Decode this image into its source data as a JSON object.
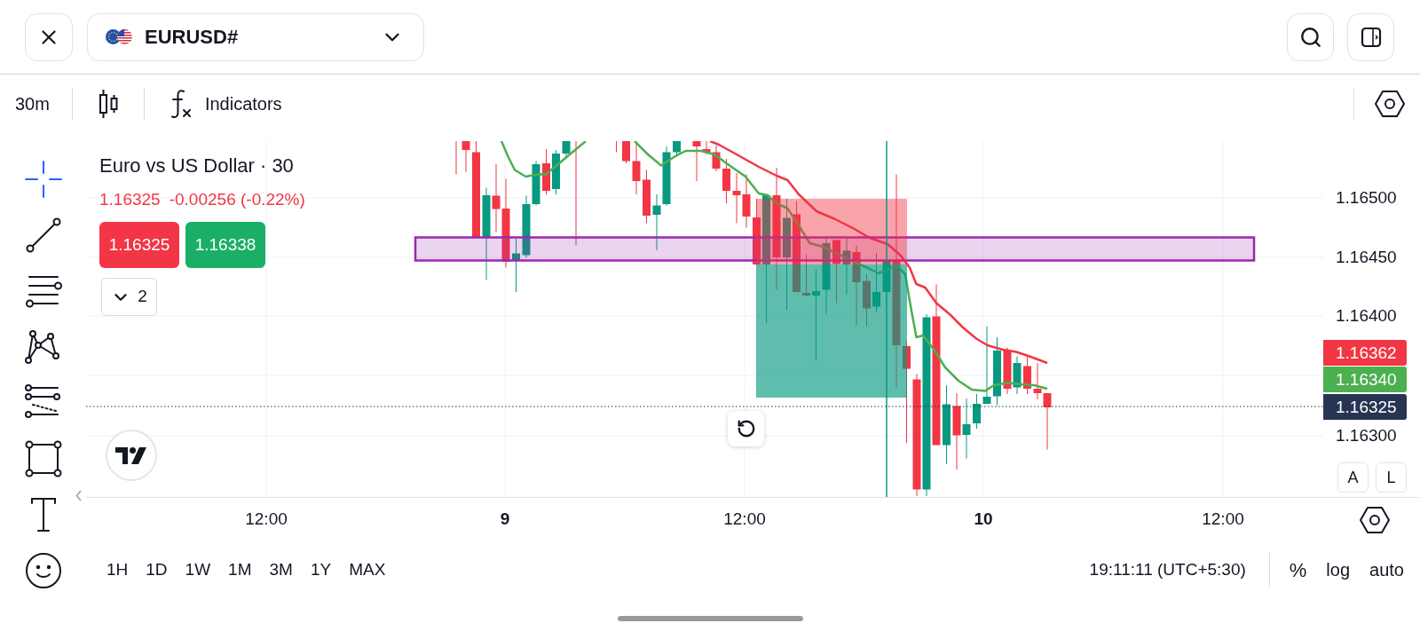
{
  "header": {
    "symbol": "EURUSD#"
  },
  "toolbar": {
    "interval": "30m",
    "indicators": "Indicators"
  },
  "drawing_tools": [
    {
      "kind": "crosshair",
      "selected": true
    },
    {
      "kind": "trend_line",
      "selected": false
    },
    {
      "kind": "channel",
      "selected": false
    },
    {
      "kind": "pattern",
      "selected": false
    },
    {
      "kind": "fib",
      "selected": false
    },
    {
      "kind": "rectangle",
      "selected": false
    },
    {
      "kind": "text",
      "selected": false
    },
    {
      "kind": "emoji",
      "selected": false
    }
  ],
  "legend": {
    "title": "Euro vs US Dollar · 30",
    "last_price": "1.16325",
    "change": "-0.00256 (-0.22%)",
    "negative": true,
    "quotes": [
      {
        "kind": "sell",
        "price": "1.16325"
      },
      {
        "kind": "buy",
        "price": "1.16338"
      }
    ],
    "indicators_count": "2"
  },
  "price_axis": {
    "labels": [
      "1.16500",
      "1.16450",
      "1.16400",
      "1.16300"
    ],
    "badges": [
      {
        "text": "1.16362",
        "color": "#f23645"
      },
      {
        "text": "1.16340",
        "color": "#4caf50"
      },
      {
        "text": "1.16325",
        "color": "#283552"
      }
    ],
    "buttons": [
      "A",
      "L"
    ]
  },
  "time_axis": {
    "labels": [
      {
        "text": "12:00",
        "kind": "time"
      },
      {
        "text": "9",
        "kind": "day"
      },
      {
        "text": "12:00",
        "kind": "time"
      },
      {
        "text": "10",
        "kind": "day"
      },
      {
        "text": "12:00",
        "kind": "time"
      }
    ]
  },
  "footer": {
    "ranges": [
      "1H",
      "1D",
      "1W",
      "1M",
      "3M",
      "1Y",
      "MAX"
    ],
    "clock": "19:11:11 (UTC+5:30)",
    "options": [
      "%",
      "log",
      "auto"
    ]
  }
}
